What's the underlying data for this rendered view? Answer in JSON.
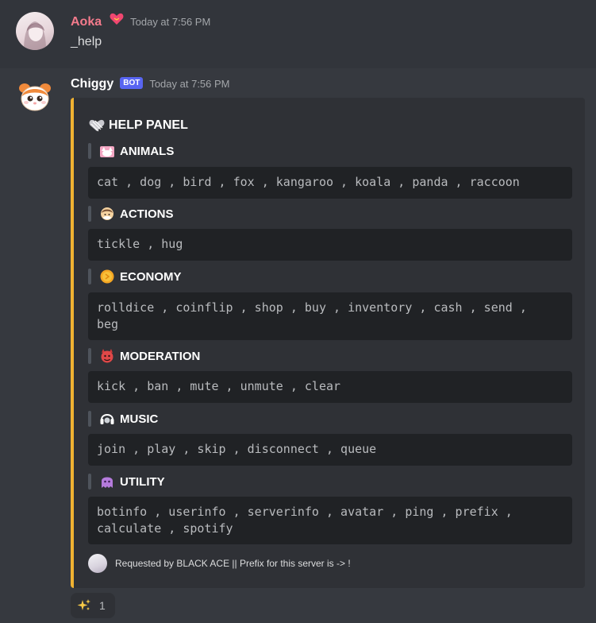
{
  "messages": [
    {
      "author": "Aoka",
      "timestamp": "Today at 7:56 PM",
      "content": "_help"
    },
    {
      "author": "Chiggy",
      "bot_tag": "BOT",
      "timestamp": "Today at 7:56 PM"
    }
  ],
  "embed": {
    "accent_color": "#f0b232",
    "title": "HELP PANEL",
    "fields": [
      {
        "name": "ANIMALS",
        "icon": "cat-emoji-icon",
        "value": "cat , dog , bird , fox , kangaroo , koala , panda , raccoon"
      },
      {
        "name": "ACTIONS",
        "icon": "hug-emoji-icon",
        "value": "tickle , hug"
      },
      {
        "name": "ECONOMY",
        "icon": "coin-emoji-icon",
        "value": "rolldice , coinflip , shop , buy , inventory , cash , send ,\nbeg"
      },
      {
        "name": "MODERATION",
        "icon": "devil-emoji-icon",
        "value": "kick , ban , mute , unmute , clear"
      },
      {
        "name": "MUSIC",
        "icon": "headphones-emoji-icon",
        "value": "join , play , skip , disconnect , queue"
      },
      {
        "name": "UTILITY",
        "icon": "ghost-emoji-icon",
        "value": "botinfo , userinfo , serverinfo , avatar , ping , prefix ,\ncalculate , spotify"
      }
    ],
    "footer": "Requested by BLACK ACE || Prefix for this server is -> !"
  },
  "reaction": {
    "icon": "sparkles-icon",
    "count": "1"
  }
}
